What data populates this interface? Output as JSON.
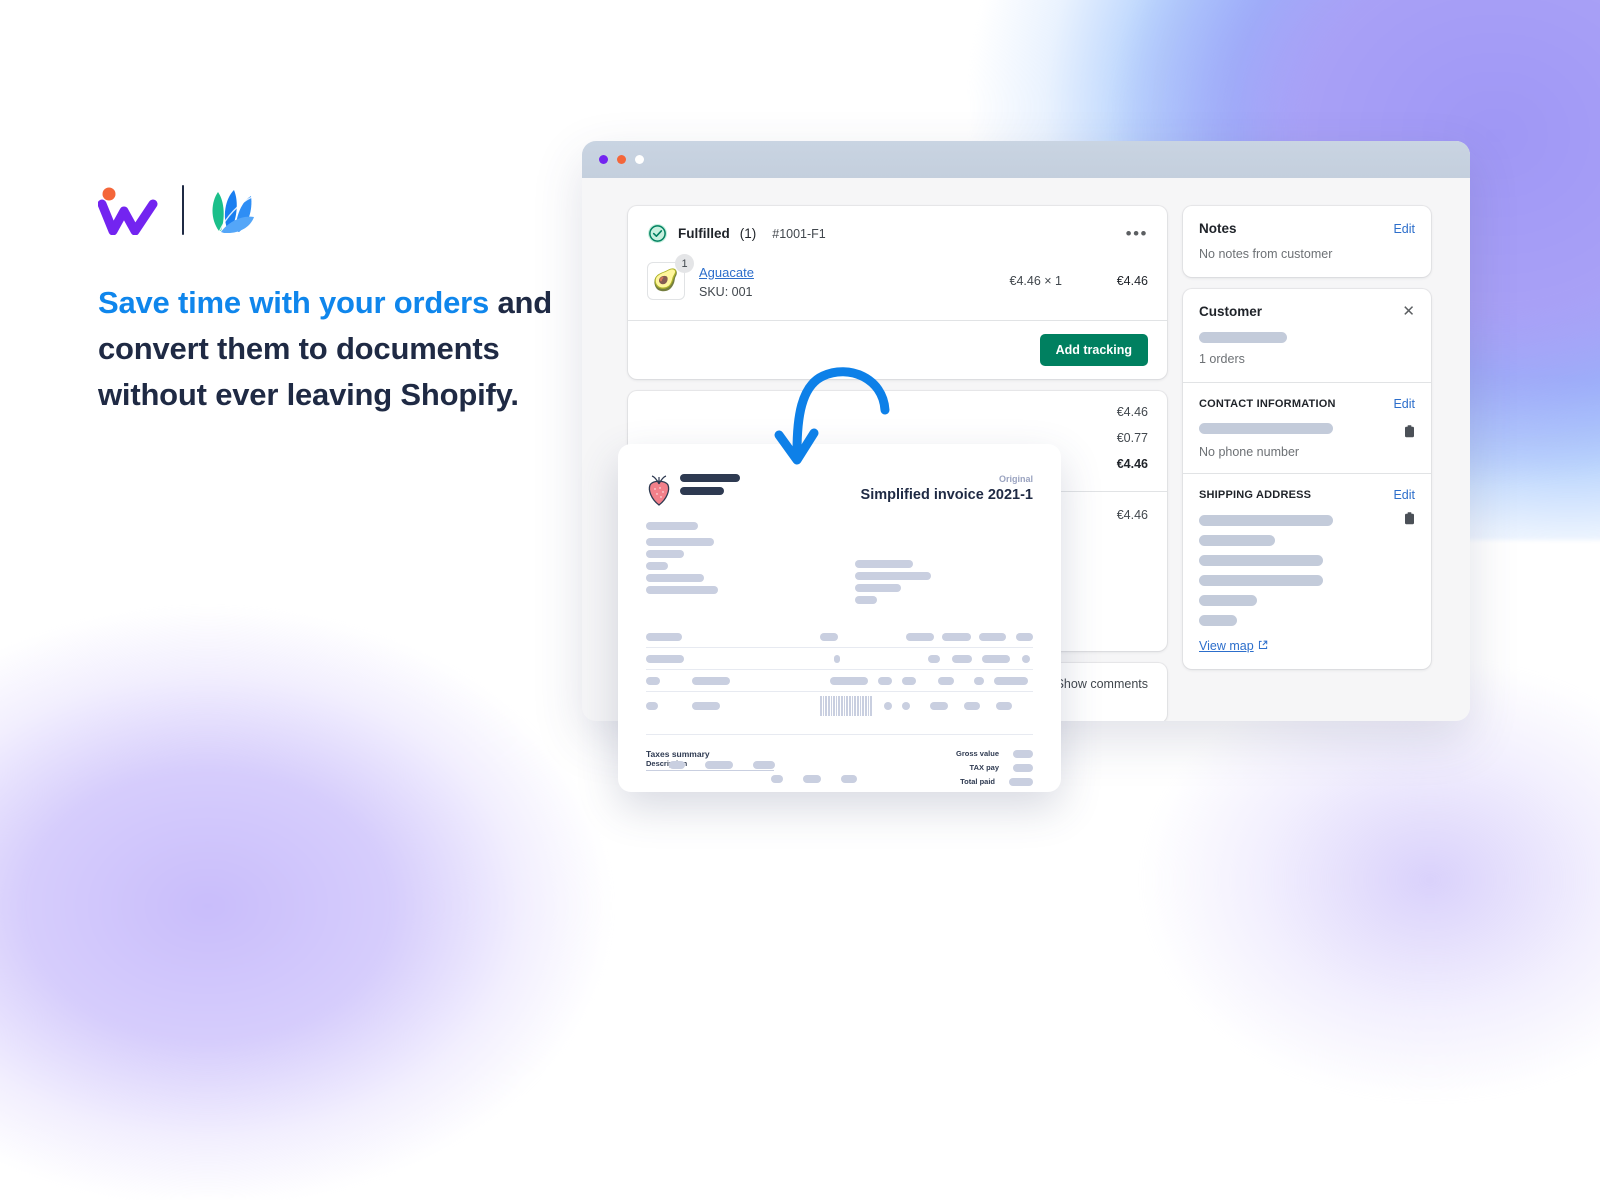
{
  "marketing": {
    "logo_w_alt": "workflow-w-logo",
    "logo_petals_alt": "petals-logo",
    "headline_accent": "Save time with your orders",
    "headline_rest": "and convert them to documents without ever leaving Shopify.",
    "accent_color": "#0f86ec",
    "text_color": "#1f2a44"
  },
  "browser": {
    "dots": [
      "purple",
      "orange",
      "white"
    ],
    "dot_colors": [
      "#7324f0",
      "#f4663a",
      "#ffffff"
    ]
  },
  "order": {
    "fulfillment": {
      "status": "Fulfilled",
      "count": "(1)",
      "id": "#1001-F1",
      "menu": "•••",
      "status_icon": "check-circle-icon",
      "status_color": "#008060"
    },
    "line_item": {
      "quantity_badge": "1",
      "thumb_icon": "avocado-image",
      "name": "Aguacate",
      "sku": "SKU: 001",
      "unit_price": "€4.46 × 1",
      "total": "€4.46"
    },
    "add_tracking_label": "Add tracking",
    "button_color": "#008060",
    "summary_prices": [
      "€4.46",
      "€0.77",
      "€4.46"
    ],
    "paid_amount": "€4.46",
    "show_comments_label": "Show comments"
  },
  "sidebar": {
    "notes": {
      "title": "Notes",
      "edit_label": "Edit",
      "empty_text": "No notes from customer"
    },
    "customer": {
      "title": "Customer",
      "close_icon": "close-icon",
      "orders_count": "1 orders"
    },
    "contact": {
      "label": "CONTACT INFORMATION",
      "edit_label": "Edit",
      "copy_icon": "clipboard-icon",
      "no_phone": "No phone number"
    },
    "shipping": {
      "label": "SHIPPING ADDRESS",
      "edit_label": "Edit",
      "copy_icon": "clipboard-icon",
      "view_map_label": "View map",
      "external_icon": "external-link-icon"
    }
  },
  "invoice": {
    "logo_icon": "strawberry-logo",
    "original_label": "Original",
    "title": "Simplified invoice 2021-1",
    "taxes_summary_label": "Taxes summary",
    "description_label": "Description",
    "totals": [
      {
        "label": "Gross value"
      },
      {
        "label": "TAX pay"
      },
      {
        "label": "Total paid"
      }
    ],
    "barcode_alt": "barcode"
  },
  "arrow": {
    "alt": "curved-down-arrow",
    "color": "#0d80e8"
  }
}
